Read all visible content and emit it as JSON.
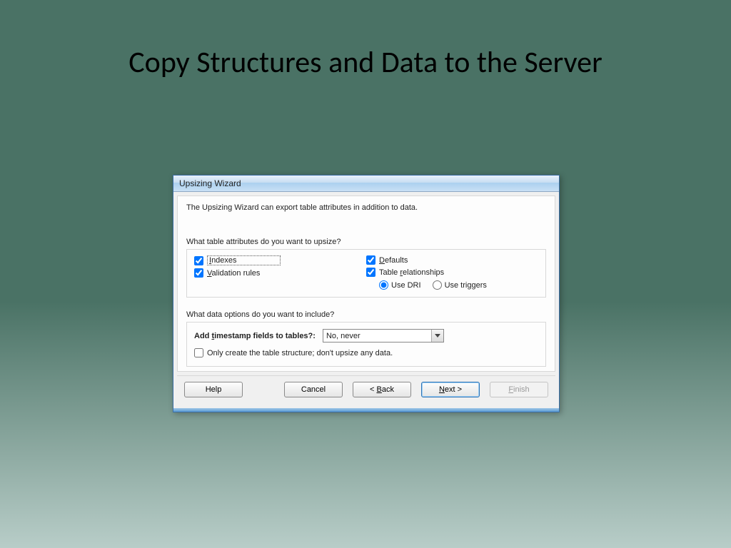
{
  "slide": {
    "title": "Copy Structures and Data to the Server"
  },
  "dialog": {
    "title": "Upsizing  Wizard",
    "intro": "The Upsizing Wizard can export table attributes in addition to data.",
    "q1": "What table attributes do you want to upsize?",
    "attrs": {
      "indexes": "Indexes",
      "validation": "Validation rules",
      "defaults": "Defaults",
      "relationships": "Table relationships"
    },
    "radios": {
      "dri": "Use DRI",
      "triggers": "Use triggers"
    },
    "q2": "What data options do you want to include?",
    "ts_label": "Add timestamp fields to tables?:",
    "ts_value": "No, never",
    "only_structure": "Only create the table structure; don't upsize any data."
  },
  "buttons": {
    "help": "Help",
    "cancel": "Cancel",
    "back": "< Back",
    "next": "Next >",
    "finish": "Finish"
  }
}
